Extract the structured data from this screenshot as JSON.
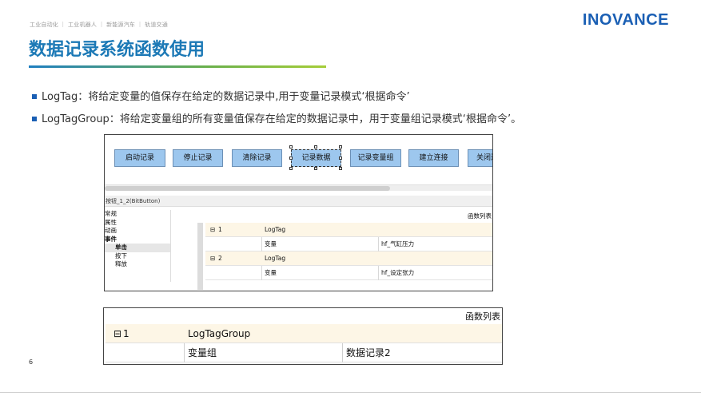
{
  "header": {
    "nav": "工业自动化 ｜ 工业机器人 ｜ 新能源汽车 ｜ 轨道交通",
    "logo": "INOVANCE",
    "title": "数据记录系统函数使用"
  },
  "bullets": [
    "LogTag：将给定变量的值保存在给定的数据记录中,用于变量记录模式‘根据命令’",
    "LogTagGroup：将给定变量组的所有变量值保存在给定的数据记录中，用于变量组记录模式‘根据命令’。"
  ],
  "screenshot1": {
    "buttons": [
      "启动记录",
      "停止记录",
      "清除记录",
      "记录数据",
      "记录变量组",
      "建立连接",
      "关闭连"
    ],
    "props_header": "按钮_1_2(BitButton)",
    "tree": [
      "常规",
      "属性",
      "动画",
      "事件",
      "单击",
      "按下",
      "释放"
    ],
    "function_list_label": "函数列表",
    "rows": [
      {
        "index": "1",
        "name": "LogTag",
        "param": "变量",
        "value": "hf_气缸压力"
      },
      {
        "index": "2",
        "name": "LogTag",
        "param": "变量",
        "value": "hf_设定张力"
      }
    ]
  },
  "screenshot2": {
    "function_list_label": "函数列表",
    "index": "1",
    "name": "LogTagGroup",
    "param": "变量组",
    "value": "数据记录2"
  },
  "page_number": "6",
  "colors": {
    "brand_blue": "#1a5fb4",
    "title_blue": "#1c79b6",
    "button_blue": "#9dc7ee",
    "accent_green": "#a6ce39"
  }
}
